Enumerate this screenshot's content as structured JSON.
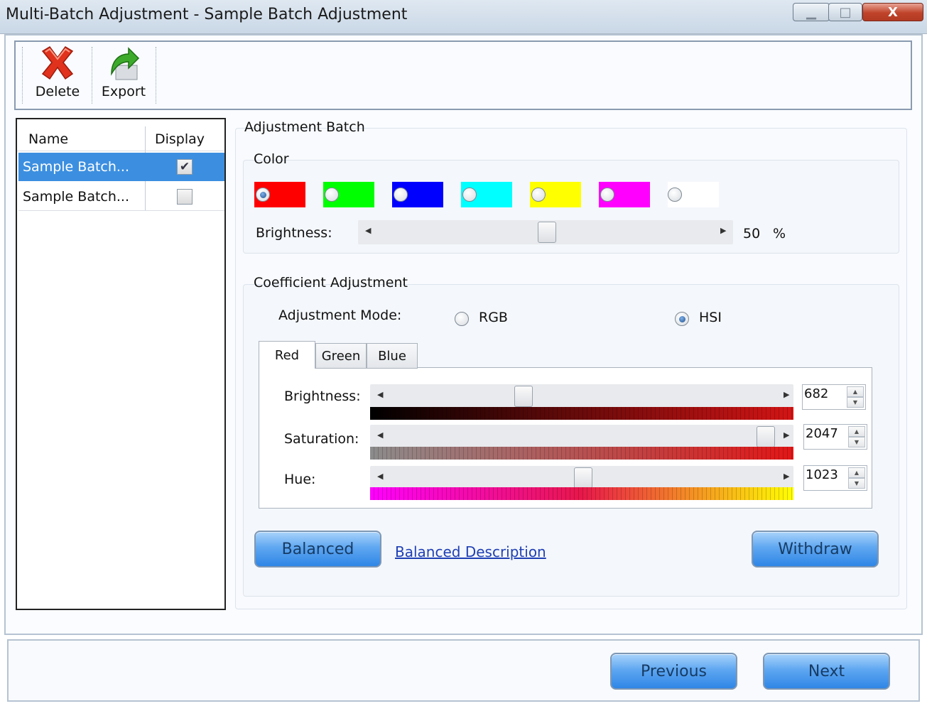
{
  "window": {
    "title": "Multi-Batch Adjustment - Sample Batch Adjustment",
    "minimize_label": "▁",
    "maximize_label": "□",
    "close_label": "X"
  },
  "toolbar": {
    "delete_label": "Delete",
    "export_label": "Export"
  },
  "batch_list": {
    "columns": [
      "Name",
      "Display"
    ],
    "rows": [
      {
        "name": "Sample Batch...",
        "display": true,
        "selected": true
      },
      {
        "name": "Sample Batch...",
        "display": false,
        "selected": false
      }
    ]
  },
  "adjustment_batch": {
    "group_label": "Adjustment Batch",
    "color": {
      "group_label": "Color",
      "swatches": [
        {
          "name": "red",
          "hex": "#ff0000",
          "selected": true
        },
        {
          "name": "green",
          "hex": "#00ff00",
          "selected": false
        },
        {
          "name": "blue",
          "hex": "#0000ff",
          "selected": false
        },
        {
          "name": "cyan",
          "hex": "#00ffff",
          "selected": false
        },
        {
          "name": "yellow",
          "hex": "#ffff00",
          "selected": false
        },
        {
          "name": "magenta",
          "hex": "#ff00ff",
          "selected": false
        },
        {
          "name": "white",
          "hex": "#ffffff",
          "selected": false
        }
      ],
      "brightness_label": "Brightness:",
      "brightness_value": "50",
      "brightness_unit": "%"
    },
    "coefficient": {
      "group_label": "Coefficient Adjustment",
      "mode_label": "Adjustment Mode:",
      "mode_rgb": "RGB",
      "mode_hsi": "HSI",
      "selected_mode": "HSI",
      "tabs": [
        "Red",
        "Green",
        "Blue"
      ],
      "active_tab": "Red",
      "brightness_label": "Brightness:",
      "brightness_value": "682",
      "saturation_label": "Saturation:",
      "saturation_value": "2047",
      "hue_label": "Hue:",
      "hue_value": "1023"
    },
    "balanced_label": "Balanced",
    "balanced_description_label": "Balanced Description",
    "withdraw_label": "Withdraw"
  },
  "footer": {
    "previous_label": "Previous",
    "next_label": "Next"
  }
}
